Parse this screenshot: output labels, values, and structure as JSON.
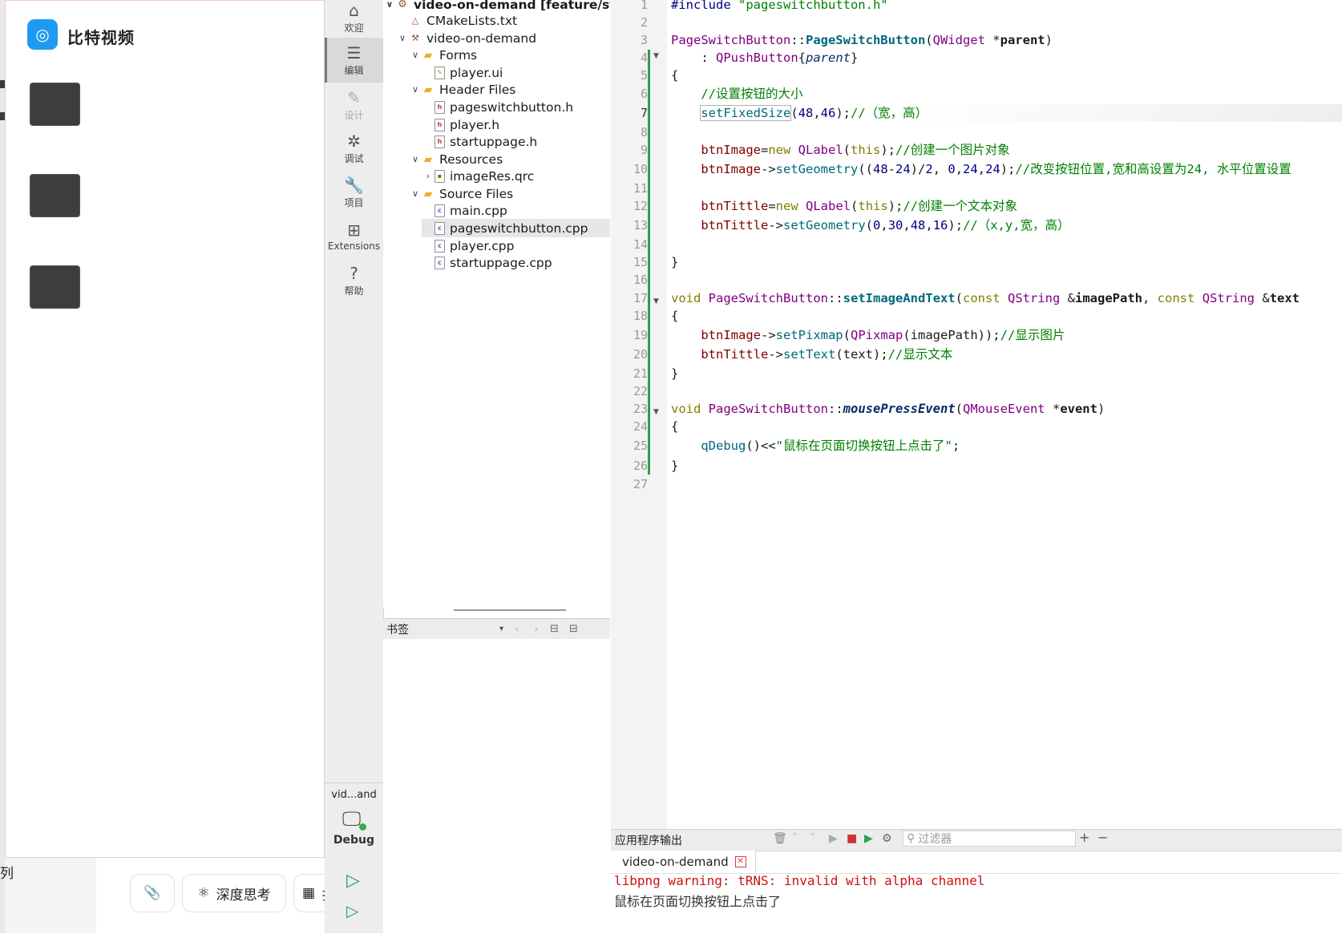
{
  "background_app": {
    "chips": [
      {
        "icon": "📎",
        "label": ""
      },
      {
        "icon": "⚛",
        "label": "深度思考"
      },
      {
        "icon": "▦",
        "label": "扌"
      }
    ],
    "left_char": "列"
  },
  "video_app": {
    "logo_glyph": "◎",
    "title": "比特视频",
    "page_buttons": 3
  },
  "mode_bar": {
    "items": [
      {
        "icon": "⌂",
        "label": "欢迎"
      },
      {
        "icon": "☰",
        "label": "编辑"
      },
      {
        "icon": "✎",
        "label": "设计"
      },
      {
        "icon": "✲",
        "label": "调试"
      },
      {
        "icon": "🔧",
        "label": "项目"
      },
      {
        "icon": "⊞",
        "label": "Extensions"
      },
      {
        "icon": "?",
        "label": "帮助"
      }
    ],
    "target_name": "vid...and",
    "target_config": "Debug",
    "run_icon": "▷",
    "debug_run_icon": "▷"
  },
  "project_tree": {
    "rows": [
      {
        "label": "video-on-demand [feature/star",
        "arrow": "∨",
        "icon": "proj"
      },
      {
        "label": "CMakeLists.txt",
        "arrow": "",
        "icon": "cmake"
      },
      {
        "label": "video-on-demand",
        "arrow": "∨",
        "icon": "hammer"
      },
      {
        "label": "Forms",
        "arrow": "∨",
        "icon": "folder"
      },
      {
        "label": "player.ui",
        "arrow": "",
        "icon": "ui"
      },
      {
        "label": "Header Files",
        "arrow": "∨",
        "icon": "folder"
      },
      {
        "label": "pageswitchbutton.h",
        "arrow": "",
        "icon": "h"
      },
      {
        "label": "player.h",
        "arrow": "",
        "icon": "h"
      },
      {
        "label": "startuppage.h",
        "arrow": "",
        "icon": "h"
      },
      {
        "label": "Resources",
        "arrow": "∨",
        "icon": "folder"
      },
      {
        "label": "imageRes.qrc",
        "arrow": "›",
        "icon": "qrc"
      },
      {
        "label": "Source Files",
        "arrow": "∨",
        "icon": "folder"
      },
      {
        "label": "main.cpp",
        "arrow": "",
        "icon": "cpp"
      },
      {
        "label": "pageswitchbutton.cpp",
        "arrow": "",
        "icon": "cpp"
      },
      {
        "label": "player.cpp",
        "arrow": "",
        "icon": "cpp"
      },
      {
        "label": "startuppage.cpp",
        "arrow": "",
        "icon": "cpp"
      }
    ],
    "selected": "pageswitchbutton.cpp"
  },
  "bookmarks": {
    "title": "书签"
  },
  "editor": {
    "current_line": 7,
    "lines": [
      "1",
      "2",
      "3",
      "4",
      "5",
      "6",
      "7",
      "8",
      "9",
      "10",
      "11",
      "12",
      "13",
      "14",
      "15",
      "16",
      "17",
      "18",
      "19",
      "20",
      "21",
      "22",
      "23",
      "24",
      "25",
      "26",
      "27"
    ]
  },
  "output": {
    "title": "应用程序输出",
    "filter_placeholder": "过滤器",
    "tab_label": "video-on-demand",
    "warning": "libpng warning: tRNS: invalid with alpha channel",
    "message": "鼠标在页面切换按钮上点击了"
  }
}
